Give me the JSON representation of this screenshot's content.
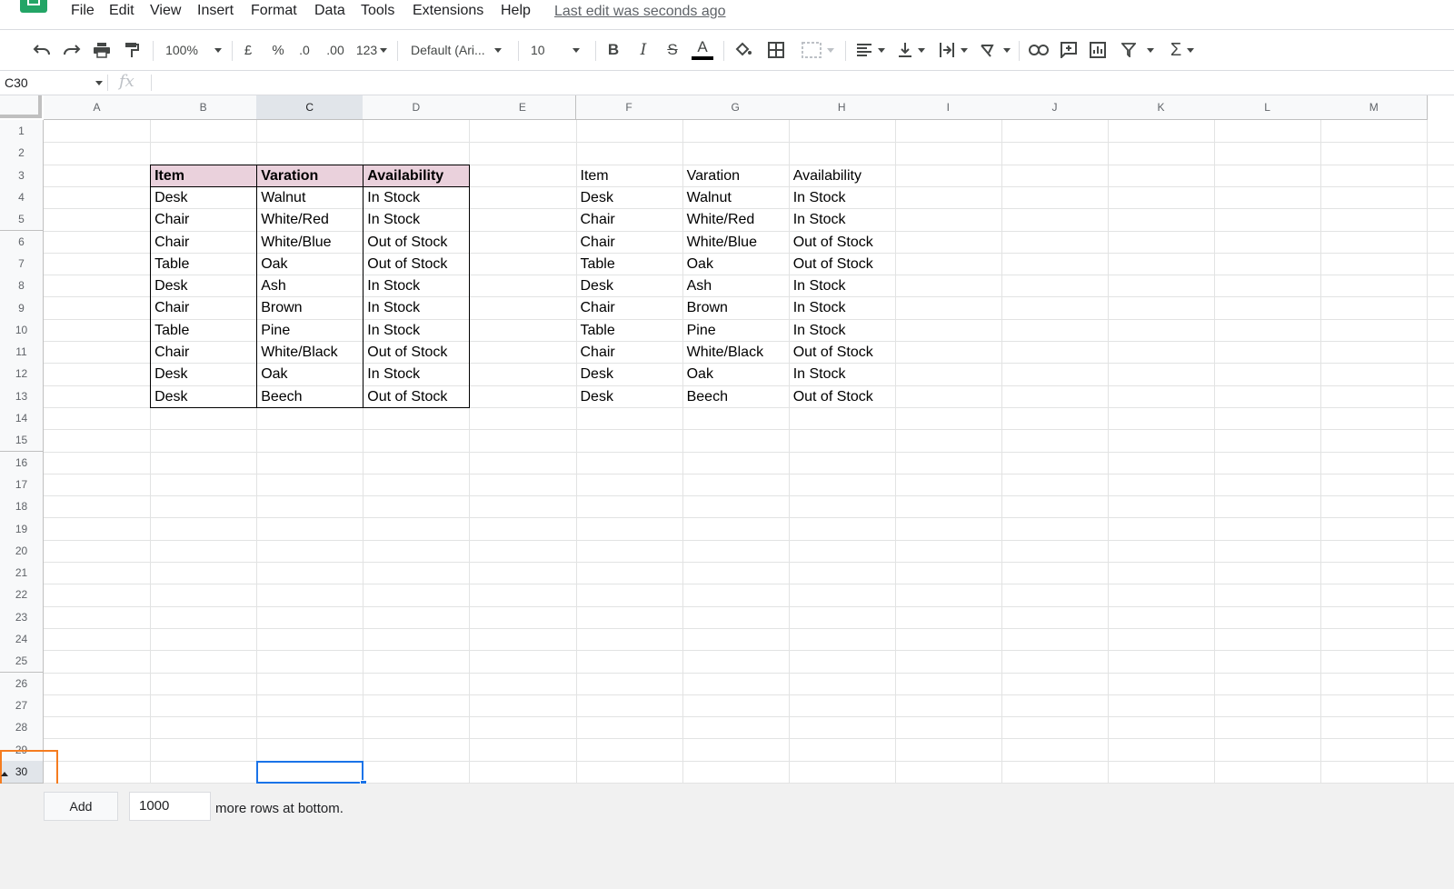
{
  "menu": {
    "items": [
      "File",
      "Edit",
      "View",
      "Insert",
      "Format",
      "Data",
      "Tools",
      "Extensions",
      "Help"
    ],
    "last_edit": "Last edit was seconds ago"
  },
  "toolbar": {
    "zoom": "100%",
    "currency": "£",
    "percent": "%",
    "decrease_decimal": ".0",
    "increase_decimal": ".00",
    "more_formats": "123",
    "font": "Default (Ari...",
    "font_size": "10"
  },
  "formula_bar": {
    "name_box": "C30",
    "fx": "fx",
    "value": ""
  },
  "columns": [
    "A",
    "B",
    "C",
    "D",
    "E",
    "F",
    "G",
    "H",
    "I",
    "J",
    "K",
    "L",
    "M"
  ],
  "selected_column": "C",
  "rows": [
    "1",
    "2",
    "3",
    "4",
    "5",
    "6",
    "7",
    "8",
    "9",
    "10",
    "11",
    "12",
    "13",
    "14",
    "15",
    "16",
    "17",
    "18",
    "19",
    "20",
    "21",
    "22",
    "23",
    "24",
    "25",
    "26",
    "27",
    "28",
    "29",
    "30"
  ],
  "selected_row": "30",
  "table_left": {
    "headers": [
      "Item",
      "Varation",
      "Availability"
    ],
    "rows": [
      [
        "Desk",
        "Walnut",
        "In Stock"
      ],
      [
        "Chair",
        "White/Red",
        "In Stock"
      ],
      [
        "Chair",
        "White/Blue",
        "Out of Stock"
      ],
      [
        "Table",
        "Oak",
        "Out of Stock"
      ],
      [
        "Desk",
        "Ash",
        "In Stock"
      ],
      [
        "Chair",
        "Brown",
        "In Stock"
      ],
      [
        "Table",
        "Pine",
        "In Stock"
      ],
      [
        "Chair",
        "White/Black",
        "Out of Stock"
      ],
      [
        "Desk",
        "Oak",
        "In Stock"
      ],
      [
        "Desk",
        "Beech",
        "Out of Stock"
      ]
    ]
  },
  "table_right": {
    "headers": [
      "Item",
      "Varation",
      "Availability"
    ],
    "rows": [
      [
        "Desk",
        "Walnut",
        "In Stock"
      ],
      [
        "Chair",
        "White/Red",
        "In Stock"
      ],
      [
        "Chair",
        "White/Blue",
        "Out of Stock"
      ],
      [
        "Table",
        "Oak",
        "Out of Stock"
      ],
      [
        "Desk",
        "Ash",
        "In Stock"
      ],
      [
        "Chair",
        "Brown",
        "In Stock"
      ],
      [
        "Table",
        "Pine",
        "In Stock"
      ],
      [
        "Chair",
        "White/Black",
        "Out of Stock"
      ],
      [
        "Desk",
        "Oak",
        "In Stock"
      ],
      [
        "Desk",
        "Beech",
        "Out of Stock"
      ]
    ]
  },
  "bottom": {
    "add_label": "Add",
    "rows_value": "1000",
    "more_rows_text": "more rows at bottom."
  },
  "colors": {
    "header_fill": "#ead1dc",
    "selection": "#1a73e8",
    "highlight": "#f57c1f"
  }
}
